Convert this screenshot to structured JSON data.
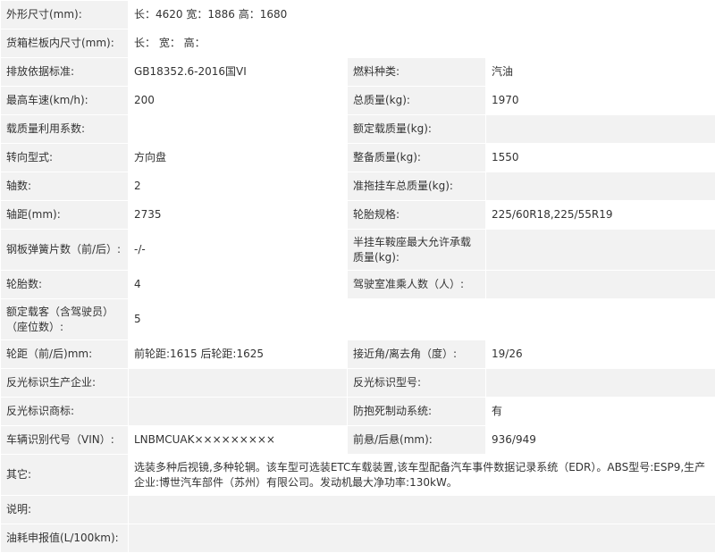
{
  "rows": [
    {
      "l1": "外形尺寸(mm):",
      "v1": "长：4620 宽：1886 高：1680"
    },
    {
      "l1": "货箱栏板内尺寸(mm):",
      "v1": "长： 宽： 高："
    },
    {
      "l1": "排放依据标准:",
      "v1": "GB18352.6-2016国VI",
      "l2": "燃料种类:",
      "v2": "汽油"
    },
    {
      "l1": "最高车速(km/h):",
      "v1": "200",
      "l2": "总质量(kg):",
      "v2": "1970"
    },
    {
      "l1": "载质量利用系数:",
      "v1": "",
      "l2": "额定载质量(kg):",
      "v2": ""
    },
    {
      "l1": "转向型式:",
      "v1": "方向盘",
      "l2": "整备质量(kg):",
      "v2": "1550"
    },
    {
      "l1": "轴数:",
      "v1": "2",
      "l2": "准拖挂车总质量(kg):",
      "v2": ""
    },
    {
      "l1": "轴距(mm):",
      "v1": "2735",
      "l2": "轮胎规格:",
      "v2": "225/60R18,225/55R19"
    },
    {
      "l1": "钢板弹簧片数（前/后）:",
      "v1": "-/-",
      "l2": "半挂车鞍座最大允许承载质量(kg):",
      "v2": ""
    },
    {
      "l1": "轮胎数:",
      "v1": "4",
      "l2": "驾驶室准乘人数（人）:",
      "v2": ""
    },
    {
      "l1": "额定载客（含驾驶员）（座位数）:",
      "v1": "5"
    },
    {
      "l1": "轮距（前/后)mm:",
      "v1": "前轮距:1615 后轮距:1625",
      "l2": "接近角/离去角（度）:",
      "v2": "19/26"
    },
    {
      "l1": "反光标识生产企业:",
      "v1": "",
      "l2": "反光标识型号:",
      "v2": ""
    },
    {
      "l1": "反光标识商标:",
      "v1": "",
      "l2": "防抱死制动系统:",
      "v2": "有"
    },
    {
      "l1": "车辆识别代号（VIN）:",
      "v1": "LNBMCUAK×××××××××",
      "l2": "前悬/后悬(mm):",
      "v2": "936/949"
    },
    {
      "l1": "其它:",
      "v1": "选装多种后视镜,多种轮辋。该车型可选装ETC车载装置,该车型配备汽车事件数据记录系统（EDR）。ABS型号:ESP9,生产企业:博世汽车部件（苏州）有限公司。发动机最大净功率:130kW。"
    },
    {
      "l1": "说明:",
      "v1": ""
    },
    {
      "l1": "油耗申报值(L/100km):",
      "v1": ""
    }
  ]
}
